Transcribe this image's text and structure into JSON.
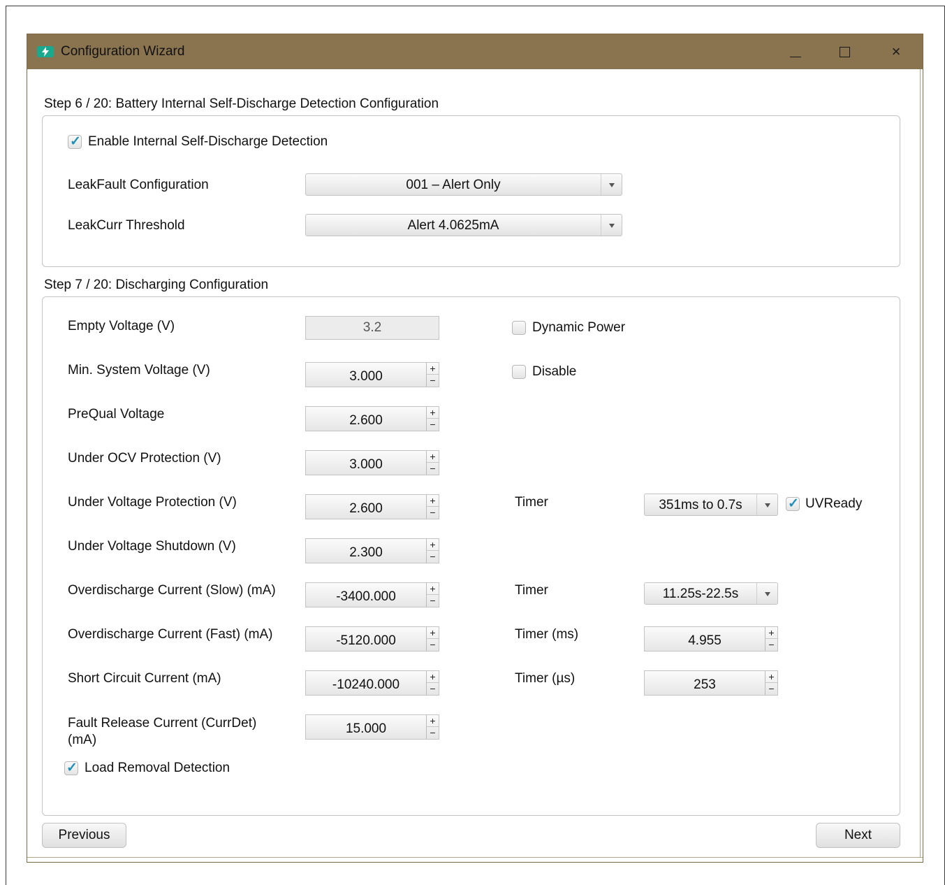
{
  "window": {
    "title": "Configuration Wizard",
    "icon": "lightning-icon",
    "controls": {
      "minimize": "minimize-icon",
      "maximize": "maximize-icon",
      "close": "×"
    }
  },
  "step6": {
    "title": "Step 6 / 20: Battery Internal Self-Discharge Detection Configuration",
    "enable_label": "Enable Internal Self-Discharge Detection",
    "enable_checked": true,
    "leakfault_label": "LeakFault Configuration",
    "leakfault_value": "001 – Alert Only",
    "leakcurr_label": "LeakCurr Threshold",
    "leakcurr_value": "Alert 4.0625mA"
  },
  "step7": {
    "title": "Step 7 / 20: Discharging Configuration",
    "empty_voltage": {
      "label": "Empty Voltage (V)",
      "value": "3.2"
    },
    "dynamic_power": {
      "label": "Dynamic Power",
      "checked": false
    },
    "min_system_voltage": {
      "label": "Min. System Voltage (V)",
      "value": "3.000"
    },
    "disable": {
      "label": "Disable",
      "checked": false
    },
    "prequal_voltage": {
      "label": "PreQual Voltage",
      "value": "2.600"
    },
    "under_ocv": {
      "label": "Under OCV Protection (V)",
      "value": "3.000"
    },
    "under_voltage_protection": {
      "label": "Under Voltage Protection (V)",
      "value": "2.600"
    },
    "uv_timer": {
      "label": "Timer",
      "value": "351ms to 0.7s"
    },
    "uvready": {
      "label": "UVReady",
      "checked": true
    },
    "under_voltage_shutdown": {
      "label": "Under Voltage Shutdown (V)",
      "value": "2.300"
    },
    "od_slow": {
      "label": "Overdischarge Current (Slow) (mA)",
      "value": "-3400.000"
    },
    "od_slow_timer": {
      "label": "Timer",
      "value": "11.25s-22.5s"
    },
    "od_fast": {
      "label": "Overdischarge Current (Fast) (mA)",
      "value": "-5120.000"
    },
    "od_fast_timer": {
      "label": "Timer (ms)",
      "value": "4.955"
    },
    "short_circuit": {
      "label": "Short Circuit Current (mA)",
      "value": "-10240.000"
    },
    "sc_timer": {
      "label": "Timer (µs)",
      "value": "253"
    },
    "fault_release": {
      "label": "Fault Release Current (CurrDet) (mA)",
      "value": "15.000"
    },
    "load_removal": {
      "label": "Load Removal Detection",
      "checked": true
    }
  },
  "buttons": {
    "previous": "Previous",
    "next": "Next"
  },
  "spin_symbols": {
    "up": "+",
    "down": "−"
  },
  "check_symbol": "✓",
  "colors": {
    "titlebar": "#8a734f",
    "check_accent": "#1e8fb8",
    "app_icon": "#19a98f"
  }
}
